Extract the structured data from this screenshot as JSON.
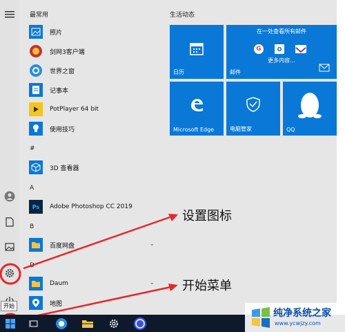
{
  "start_menu": {
    "section_most_used": "最常用",
    "most_used": [
      {
        "label": "照片",
        "icon": "photos-icon"
      },
      {
        "label": "剑网3客户端",
        "icon": "jx3-icon"
      },
      {
        "label": "世界之窗",
        "icon": "theworld-browser-icon"
      },
      {
        "label": "记事本",
        "icon": "notepad-icon"
      },
      {
        "label": "PotPlayer 64 bit",
        "icon": "potplayer-icon"
      },
      {
        "label": "使用技巧",
        "icon": "tips-icon"
      }
    ],
    "groups": [
      {
        "letter": "#",
        "items": [
          {
            "label": "3D 查看器",
            "icon": "3d-viewer-icon"
          }
        ]
      },
      {
        "letter": "A",
        "items": [
          {
            "label": "Adobe Photoshop CC 2019",
            "icon": "photoshop-icon"
          }
        ]
      },
      {
        "letter": "B",
        "items": [
          {
            "label": "百度网盘",
            "icon": "folder-icon",
            "expandable": true
          }
        ]
      },
      {
        "letter": "D",
        "items": [
          {
            "label": "Daum",
            "icon": "folder-icon",
            "expandable": true
          },
          {
            "label": "地图",
            "icon": "maps-icon"
          }
        ]
      }
    ],
    "tiles_header": "生活动态",
    "tiles": {
      "calendar": "日历",
      "mail": "邮件",
      "mail_header": "在一处查看所有邮件",
      "mail_more": "更多内容...",
      "edge": "Microsoft Edge",
      "pc_manager": "电脑管家",
      "qq": "QQ"
    }
  },
  "annotations": {
    "settings": "设置图标",
    "start": "开始菜单"
  },
  "taskbar": {
    "start_tooltip": "开始"
  },
  "watermark": {
    "title": "纯净系统之家",
    "url": "www.ycwjzy.com"
  },
  "colors": {
    "tile_blue": "#0a78d7",
    "annotation_red": "#e8262b",
    "taskbar": "#0e1a2b"
  }
}
